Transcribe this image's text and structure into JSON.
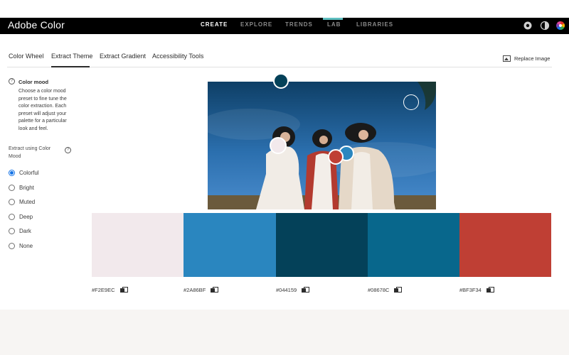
{
  "app": {
    "title": "Adobe Color"
  },
  "nav": {
    "items": [
      {
        "label": "CREATE",
        "active": true
      },
      {
        "label": "EXPLORE",
        "active": false
      },
      {
        "label": "TRENDS",
        "active": false
      },
      {
        "label": "LAB",
        "active": false
      },
      {
        "label": "LIBRARIES",
        "active": false
      }
    ],
    "icons": [
      "settings-icon",
      "theme-toggle-icon",
      "color-wheel-icon"
    ]
  },
  "tabs": [
    {
      "label": "Color Wheel",
      "active": false
    },
    {
      "label": "Extract Theme",
      "active": true
    },
    {
      "label": "Extract Gradient",
      "active": false
    },
    {
      "label": "Accessibility Tools",
      "active": false
    }
  ],
  "replace_image": {
    "label": "Replace Image",
    "icon": "image-icon"
  },
  "sidebar": {
    "mood_title": "Color mood",
    "mood_description": "Choose a color mood preset to fine tune the color extraction. Each preset will adjust your palette for a particular look and feel.",
    "extract_label": "Extract using Color Mood",
    "options": [
      {
        "label": "Colorful",
        "checked": true
      },
      {
        "label": "Bright",
        "checked": false
      },
      {
        "label": "Muted",
        "checked": false
      },
      {
        "label": "Deep",
        "checked": false
      },
      {
        "label": "Dark",
        "checked": false
      },
      {
        "label": "None",
        "checked": false
      }
    ]
  },
  "palette": [
    {
      "hex": "#F2E9EC",
      "color": "#F2E9EC"
    },
    {
      "hex": "#2A86BF",
      "color": "#2A86BF"
    },
    {
      "hex": "#044159",
      "color": "#044159"
    },
    {
      "hex": "#08678C",
      "color": "#08678C"
    },
    {
      "hex": "#BF3F34",
      "color": "#BF3F34"
    }
  ],
  "colors": {
    "accent": "#1473e6",
    "nav_background": "#000000",
    "lab_marker": "#5fbfc0"
  }
}
